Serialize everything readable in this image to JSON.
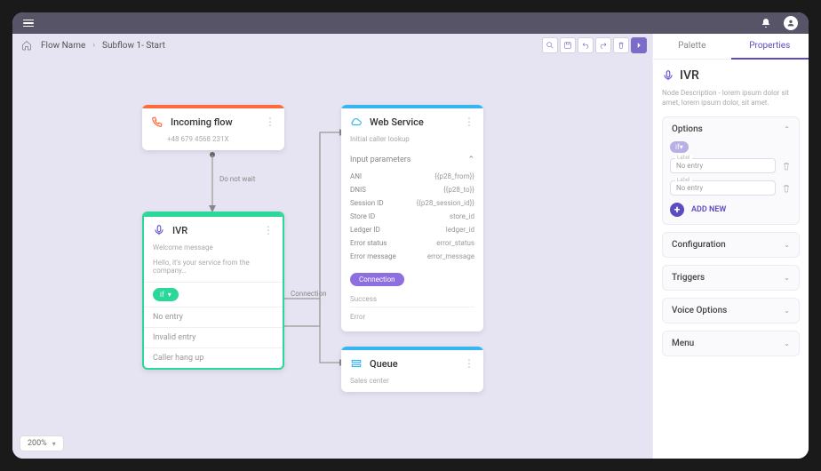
{
  "breadcrumb": {
    "item1": "Flow Name",
    "item2": "Subflow 1- Start"
  },
  "zoom": "200%",
  "edge_labels": {
    "wait": "Do not wait",
    "connection": "Connection"
  },
  "nodes": {
    "incoming": {
      "title": "Incoming flow",
      "sub": "+48 679 4568 231X"
    },
    "ivr": {
      "title": "IVR",
      "sub": "Welcome message",
      "body": "Hello, it's your service from the company…",
      "pill": "if",
      "rows": [
        "No entry",
        "Invalid entry",
        "Caller hang up"
      ]
    },
    "web": {
      "title": "Web Service",
      "sub": "Initial caller lookup",
      "section": "Input parameters",
      "params": [
        {
          "k": "ANI",
          "v": "{{p28_from}}"
        },
        {
          "k": "DNIS",
          "v": "{{p28_to}}"
        },
        {
          "k": "Session ID",
          "v": "{{p28_session_id}}"
        },
        {
          "k": "Store ID",
          "v": "store_id"
        },
        {
          "k": "Ledger ID",
          "v": "ledger_id"
        },
        {
          "k": "Error status",
          "v": "error_status"
        },
        {
          "k": "Error message",
          "v": "error_message"
        }
      ],
      "btn": "Connection",
      "status1": "Success",
      "status2": "Error"
    },
    "queue": {
      "title": "Queue",
      "sub": "Sales center"
    }
  },
  "panel": {
    "tabs": {
      "palette": "Palette",
      "properties": "Properties"
    },
    "title": "IVR",
    "desc": "Node Description - lorem ipsum dolor sit amet, lorem ipsum dolor, sit amet.",
    "options": {
      "label": "Options",
      "pill": "if",
      "field_label": "Label",
      "entries": [
        "No entry",
        "No entry"
      ],
      "add": "ADD NEW"
    },
    "sections": [
      "Configuration",
      "Triggers",
      "Voice Options",
      "Menu"
    ]
  }
}
